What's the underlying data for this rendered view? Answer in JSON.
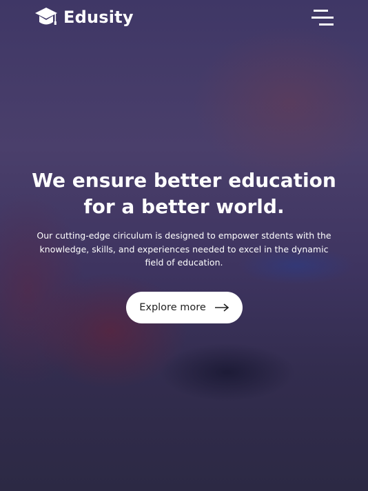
{
  "brand": {
    "name": "Edusity",
    "logo_icon": "graduation-cap-icon"
  },
  "header": {
    "menu_icon": "hamburger-menu-icon"
  },
  "hero": {
    "title_line1": "We ensure better education",
    "title_line2": "for a better world.",
    "subtitle": "Our cutting-edge ciriculum is designed to empower stdents with the knowledge, skills, and experiences needed to excel in the dynamic field of education.",
    "cta_label": "Explore more",
    "cta_icon": "arrow-right-icon"
  },
  "colors": {
    "overlay": "#3f3766",
    "button_bg": "#ffffff",
    "text": "#ffffff"
  }
}
